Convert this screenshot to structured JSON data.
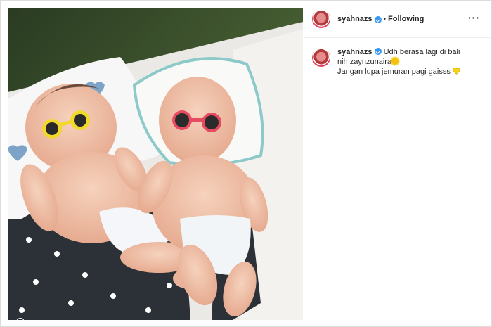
{
  "post": {
    "username": "syahnazs",
    "follow_status": "Following",
    "caption_username": "syahnazs",
    "caption_line1": "Udh berasa lagi di bali",
    "caption_line2": "nih zaynzunaira",
    "caption_line3": "Jangan lupa jemuran pagi gaisss",
    "more_label": "···"
  },
  "photo": {
    "subject": "two babies wearing sunglasses lying on white pillows",
    "sunglasses_left_color": "#f1d82a",
    "sunglasses_right_color": "#e64b61"
  },
  "icons": [
    "verified-badge-icon",
    "more-options-icon",
    "sun-emoji-icon",
    "yellow-heart-emoji-icon",
    "user-tag-icon"
  ],
  "colors": {
    "verified": "#3897f0",
    "text": "#262626",
    "divider": "#efefef"
  }
}
